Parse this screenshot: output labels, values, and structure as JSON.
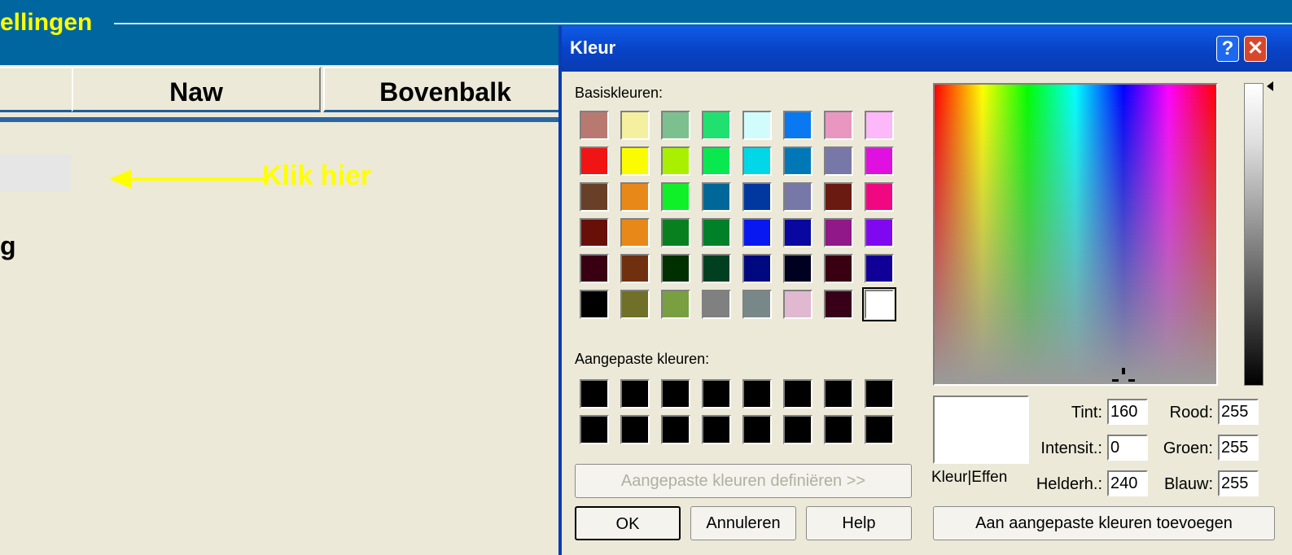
{
  "app": {
    "title_fragment": "ellingen",
    "tabs": [
      "Naw",
      "Bovenbalk"
    ],
    "hint": "Klik hier",
    "fragment_label": "g",
    "colors": {
      "header": "#0066A0",
      "hint": "#FFFF00"
    }
  },
  "dialog": {
    "title": "Kleur",
    "help_button": "?",
    "close_button": "✕",
    "basic_label": "Basiskleuren:",
    "basic_colors": [
      [
        "#B87A70",
        "#F4F0A0",
        "#7CC090",
        "#20E070",
        "#D0FCFC",
        "#0A78F0",
        "#E898C0",
        "#FCB8F8"
      ],
      [
        "#F01414",
        "#FCFC00",
        "#A8F000",
        "#0AE850",
        "#00D8E8",
        "#0078B8",
        "#7878A8",
        "#E010E0"
      ],
      [
        "#684028",
        "#E88818",
        "#10F028",
        "#006898",
        "#0038A0",
        "#7878A8",
        "#6A1A10",
        "#F00880"
      ],
      [
        "#681008",
        "#E88818",
        "#088020",
        "#008028",
        "#0818F0",
        "#0808A0",
        "#901888",
        "#8008F0"
      ],
      [
        "#380010",
        "#703010",
        "#003000",
        "#004020",
        "#000880",
        "#000020",
        "#380010",
        "#100098"
      ],
      [
        "#000000",
        "#707028",
        "#78A040",
        "#808080",
        "#788888",
        "#E0B8D0",
        "#380018",
        "#FFFFFF"
      ]
    ],
    "selected_swatch": "#FFFFFF",
    "custom_label": "Aangepaste kleuren:",
    "custom_colors": [
      [
        "#000000",
        "#000000",
        "#000000",
        "#000000",
        "#000000",
        "#000000",
        "#000000",
        "#000000"
      ],
      [
        "#000000",
        "#000000",
        "#000000",
        "#000000",
        "#000000",
        "#000000",
        "#000000",
        "#000000"
      ]
    ],
    "define_custom": "Aangepaste kleuren definiëren >>",
    "ok": "OK",
    "cancel": "Annuleren",
    "help": "Help",
    "preview_label": "Kleur|Effen",
    "fields": {
      "tint": {
        "label": "Tint:",
        "value": "160"
      },
      "intensity": {
        "label": "Intensit.:",
        "value": "0"
      },
      "brightness": {
        "label": "Helderh.:",
        "value": "240"
      },
      "red": {
        "label": "Rood:",
        "value": "255"
      },
      "green": {
        "label": "Groen:",
        "value": "255"
      },
      "blue": {
        "label": "Blauw:",
        "value": "255"
      }
    },
    "add_custom": "Aan aangepaste kleuren toevoegen",
    "current_color": "#FFFFFF"
  }
}
